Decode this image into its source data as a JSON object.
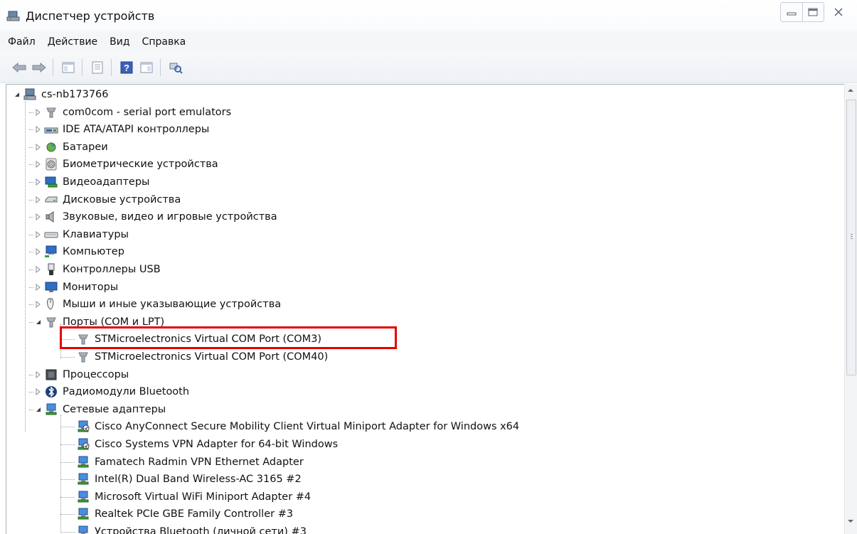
{
  "window": {
    "title": "Диспетчер устройств",
    "controls": [
      "minimize-icon",
      "maximize-icon",
      "close-icon"
    ]
  },
  "menu": {
    "items": [
      "Файл",
      "Действие",
      "Вид",
      "Справка"
    ]
  },
  "toolbar": {
    "buttons": [
      "back-arrow-icon",
      "forward-arrow-icon",
      "show-hide-tree-icon",
      "properties-icon",
      "help-icon",
      "action-pane-icon",
      "scan-hardware-icon"
    ]
  },
  "tree": {
    "root": "cs-nb173766",
    "categories": [
      {
        "label": "com0com - serial port emulators",
        "icon": "port-icon",
        "expanded": false
      },
      {
        "label": "IDE ATA/ATAPI контроллеры",
        "icon": "ide-controller-icon",
        "expanded": false
      },
      {
        "label": "Батареи",
        "icon": "battery-icon",
        "expanded": false
      },
      {
        "label": "Биометрические устройства",
        "icon": "fingerprint-icon",
        "expanded": false
      },
      {
        "label": "Видеоадаптеры",
        "icon": "display-adapter-icon",
        "expanded": false
      },
      {
        "label": "Дисковые устройства",
        "icon": "disk-drive-icon",
        "expanded": false
      },
      {
        "label": "Звуковые, видео и игровые устройства",
        "icon": "speaker-icon",
        "expanded": false
      },
      {
        "label": "Клавиатуры",
        "icon": "keyboard-icon",
        "expanded": false
      },
      {
        "label": "Компьютер",
        "icon": "computer-icon",
        "expanded": false
      },
      {
        "label": "Контроллеры USB",
        "icon": "usb-icon",
        "expanded": false
      },
      {
        "label": "Мониторы",
        "icon": "monitor-icon",
        "expanded": false
      },
      {
        "label": "Мыши и иные указывающие устройства",
        "icon": "mouse-icon",
        "expanded": false
      },
      {
        "label": "Порты (COM и LPT)",
        "icon": "port-icon",
        "expanded": true
      },
      {
        "label": "Процессоры",
        "icon": "processor-icon",
        "expanded": false
      },
      {
        "label": "Радиомодули Bluetooth",
        "icon": "bluetooth-icon",
        "expanded": false
      },
      {
        "label": "Сетевые адаптеры",
        "icon": "network-adapter-icon",
        "expanded": true
      }
    ],
    "ports_children": [
      "STMicroelectronics Virtual COM Port (COM3)",
      "STMicroelectronics Virtual COM Port (COM40)"
    ],
    "network_children": [
      "Cisco AnyConnect Secure Mobility Client Virtual Miniport Adapter for Windows x64",
      "Cisco Systems VPN Adapter for 64-bit Windows",
      "Famatech Radmin VPN Ethernet Adapter",
      "Intel(R) Dual Band Wireless-AC 3165 #2",
      "Microsoft Virtual WiFi Miniport Adapter #4",
      "Realtek PCIe GBE Family Controller #3",
      "Устройства Bluetooth (личной сети) #3"
    ]
  },
  "highlight_color": "#e60000"
}
